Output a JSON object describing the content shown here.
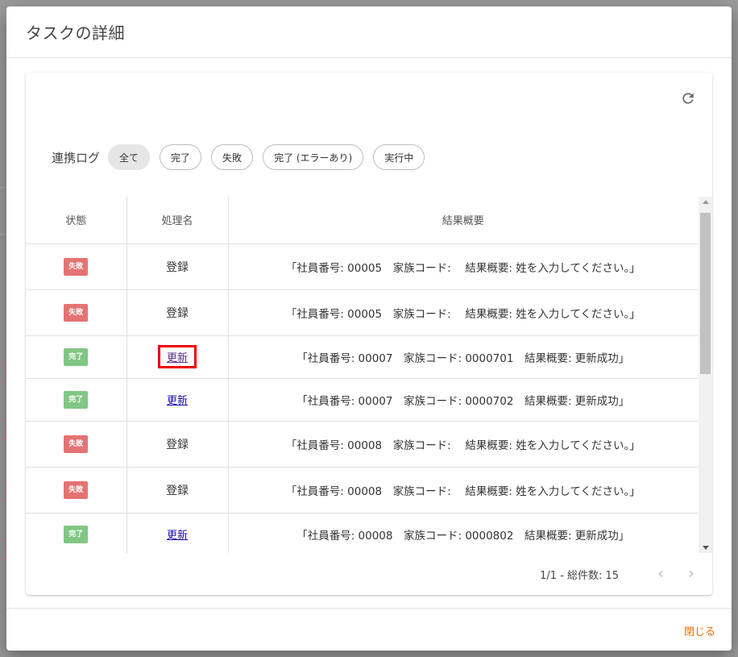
{
  "dialog": {
    "title": "タスクの詳細",
    "close_label": "閉じる"
  },
  "filters": {
    "label": "連携ログ",
    "chips": [
      {
        "label": "全て",
        "active": true
      },
      {
        "label": "完了",
        "active": false
      },
      {
        "label": "失敗",
        "active": false
      },
      {
        "label": "完了 (エラーあり)",
        "active": false
      },
      {
        "label": "実行中",
        "active": false
      }
    ]
  },
  "table": {
    "headers": [
      "状態",
      "処理名",
      "結果概要"
    ],
    "rows": [
      {
        "status": "失敗",
        "status_type": "fail",
        "process": "登録",
        "link": false,
        "summary": "「社員番号: 00005　家族コード:　 結果概要: 姓を入力してください。」"
      },
      {
        "status": "失敗",
        "status_type": "fail",
        "process": "登録",
        "link": false,
        "summary": "「社員番号: 00005　家族コード:　 結果概要: 姓を入力してください。」"
      },
      {
        "status": "完了",
        "status_type": "done",
        "process": "更新",
        "link": true,
        "summary": "「社員番号: 00007　家族コード: 0000701　結果概要: 更新成功」"
      },
      {
        "status": "完了",
        "status_type": "done",
        "process": "更新",
        "link": true,
        "summary": "「社員番号: 00007　家族コード: 0000702　結果概要: 更新成功」"
      },
      {
        "status": "失敗",
        "status_type": "fail",
        "process": "登録",
        "link": false,
        "summary": "「社員番号: 00008　家族コード:　 結果概要: 姓を入力してください。」"
      },
      {
        "status": "失敗",
        "status_type": "fail",
        "process": "登録",
        "link": false,
        "summary": "「社員番号: 00008　家族コード:　 結果概要: 姓を入力してください。」"
      },
      {
        "status": "完了",
        "status_type": "done",
        "process": "更新",
        "link": true,
        "summary": "「社員番号: 00008　家族コード: 0000802　結果概要: 更新成功」"
      }
    ]
  },
  "pagination": {
    "text": "1/1 - 総件数: 15"
  },
  "colors": {
    "fail": "#e57373",
    "done": "#81c784",
    "accent": "#ef6c00",
    "highlight": "#e00000"
  }
}
